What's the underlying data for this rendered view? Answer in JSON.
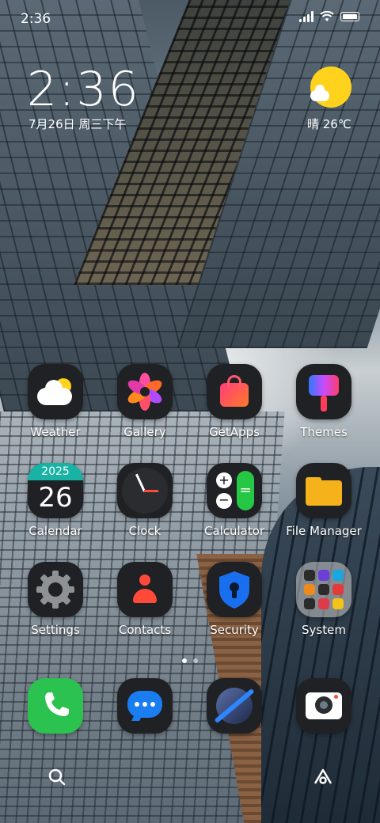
{
  "status_bar": {
    "time": "2:36",
    "battery_level": 1.0
  },
  "clock_widget": {
    "time": "2:36",
    "date": "7月26日 周三下午"
  },
  "weather_widget": {
    "text": "晴 26℃"
  },
  "apps": [
    {
      "label": "Weather",
      "icon": "weather-icon"
    },
    {
      "label": "Gallery",
      "icon": "gallery-icon"
    },
    {
      "label": "GetApps",
      "icon": "getapps-icon"
    },
    {
      "label": "Themes",
      "icon": "themes-icon"
    },
    {
      "label": "Calendar",
      "icon": "calendar-icon",
      "year": "2025",
      "day": "26"
    },
    {
      "label": "Clock",
      "icon": "clock-icon"
    },
    {
      "label": "Calculator",
      "icon": "calculator-icon"
    },
    {
      "label": "File Manager",
      "icon": "file-manager-icon"
    },
    {
      "label": "Settings",
      "icon": "settings-icon"
    },
    {
      "label": "Contacts",
      "icon": "contacts-icon"
    },
    {
      "label": "Security",
      "icon": "security-icon"
    },
    {
      "label": "System",
      "icon": "system-folder-icon"
    }
  ],
  "dock": [
    {
      "icon": "phone-icon"
    },
    {
      "icon": "messages-icon"
    },
    {
      "icon": "browser-icon"
    },
    {
      "icon": "camera-icon"
    }
  ],
  "page_indicator": {
    "pages": 2,
    "current": 1
  },
  "bottom_bar": {
    "left_icon": "search-icon",
    "right_icon": "home-icon"
  },
  "colors": {
    "sun": "#ffd21e",
    "phone_green": "#2bc24f",
    "messages_blue": "#1a7df0",
    "file_yellow": "#f5b21a",
    "calendar_teal": "#19b3a6"
  }
}
